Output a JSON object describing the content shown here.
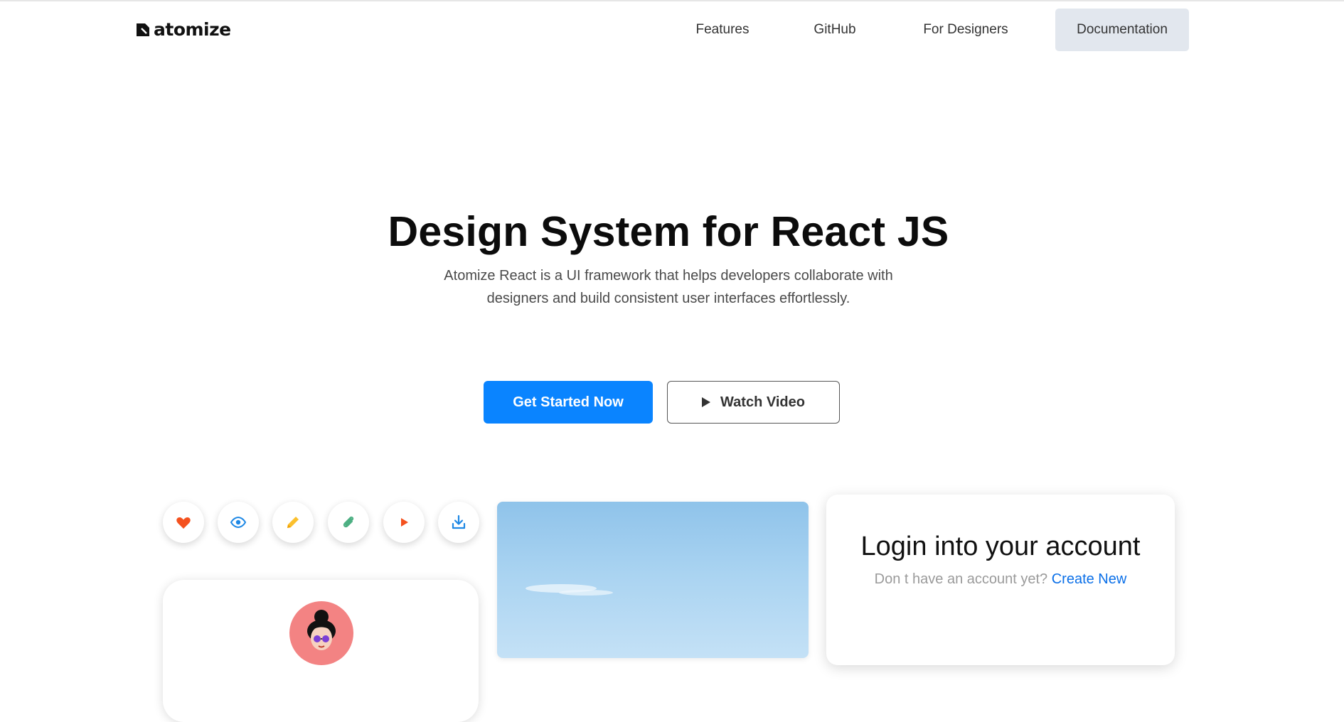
{
  "brand": {
    "name": "atomize"
  },
  "nav": {
    "items": [
      "Features",
      "GitHub",
      "For Designers"
    ],
    "documentation": "Documentation"
  },
  "hero": {
    "title": "Design System for React JS",
    "subtitle": "Atomize React is a UI framework that helps developers collaborate with designers and build consistent user interfaces effortlessly.",
    "primary_cta": "Get Started Now",
    "secondary_cta": "Watch Video"
  },
  "icons": [
    "heart-icon",
    "eye-icon",
    "pencil-icon",
    "attachment-icon",
    "play-icon",
    "download-icon"
  ],
  "login": {
    "title": "Login into your account",
    "prompt": "Don t have an account yet?",
    "link": "Create New"
  },
  "colors": {
    "primary": "#0a84ff",
    "nav_active_bg": "#e2e7ee",
    "heart": "#f4511e",
    "eye": "#1e88e5",
    "pencil": "#fbc02d",
    "attachment": "#4caf82",
    "play": "#f4511e",
    "download": "#1e88e5",
    "link": "#0a6fe8"
  }
}
